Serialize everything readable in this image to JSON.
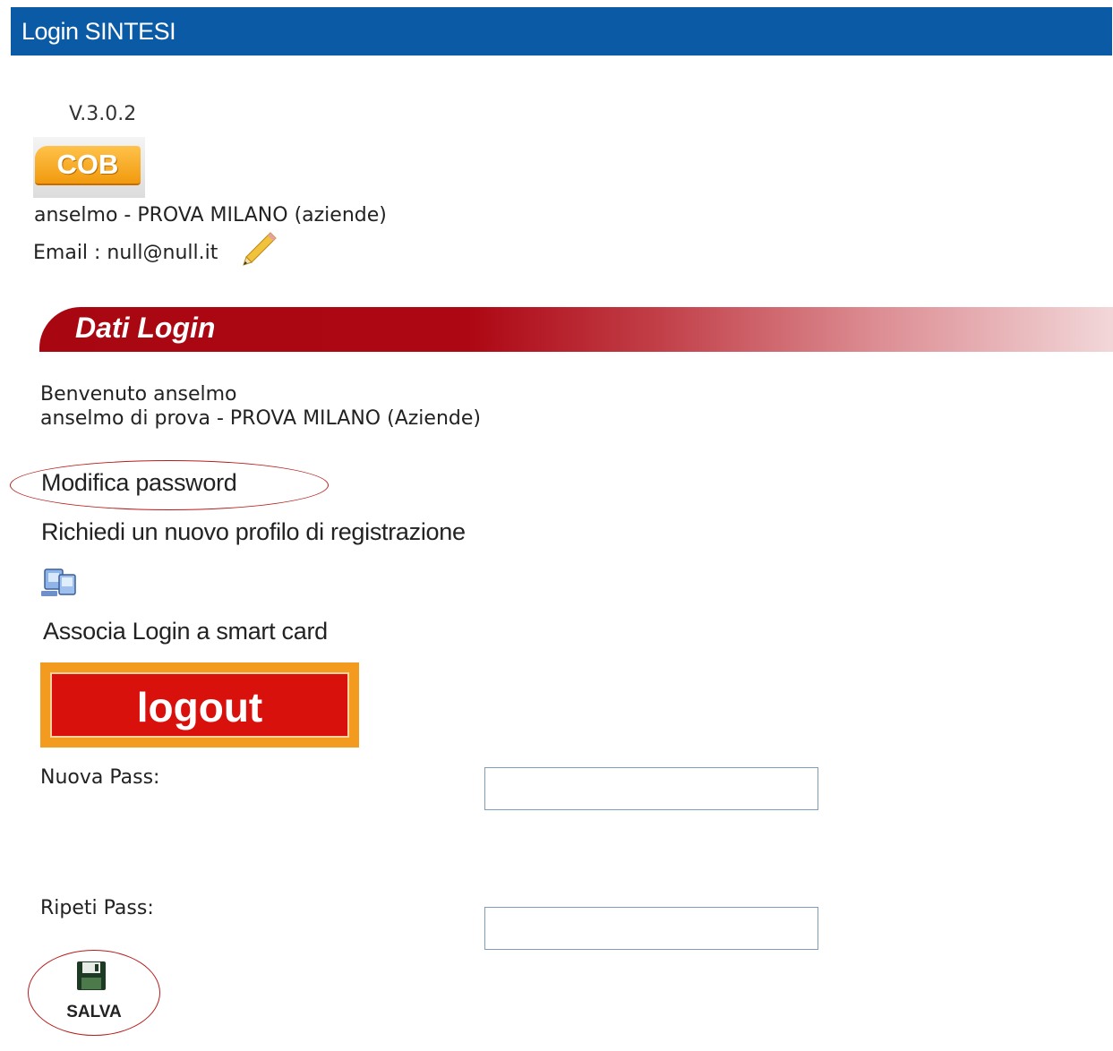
{
  "header": {
    "title": "Login SINTESI",
    "color": "#0b5aa6"
  },
  "version": "V.3.0.2",
  "logo": {
    "text": "COB"
  },
  "user": {
    "line": "anselmo - PROVA MILANO (aziende)",
    "email_line": "Email : null@null.it",
    "edit_icon": "pencil-icon"
  },
  "section": {
    "title": "Dati Login",
    "color": "#a80711"
  },
  "welcome": {
    "line1": "Benvenuto anselmo",
    "line2": "anselmo di prova - PROVA MILANO (Aziende)"
  },
  "links": {
    "change_password": "Modifica password",
    "new_profile": "Richiedi un nuovo profilo di registrazione",
    "smart_card": "Associa Login a smart card"
  },
  "icons": {
    "network": "network-computers-icon",
    "save": "floppy-disk-icon"
  },
  "logout": {
    "label": "logout"
  },
  "form": {
    "new_pass_label": "Nuova Pass:",
    "new_pass_value": "",
    "repeat_pass_label": "Ripeti Pass:",
    "repeat_pass_value": "",
    "save_label": "SALVA"
  }
}
